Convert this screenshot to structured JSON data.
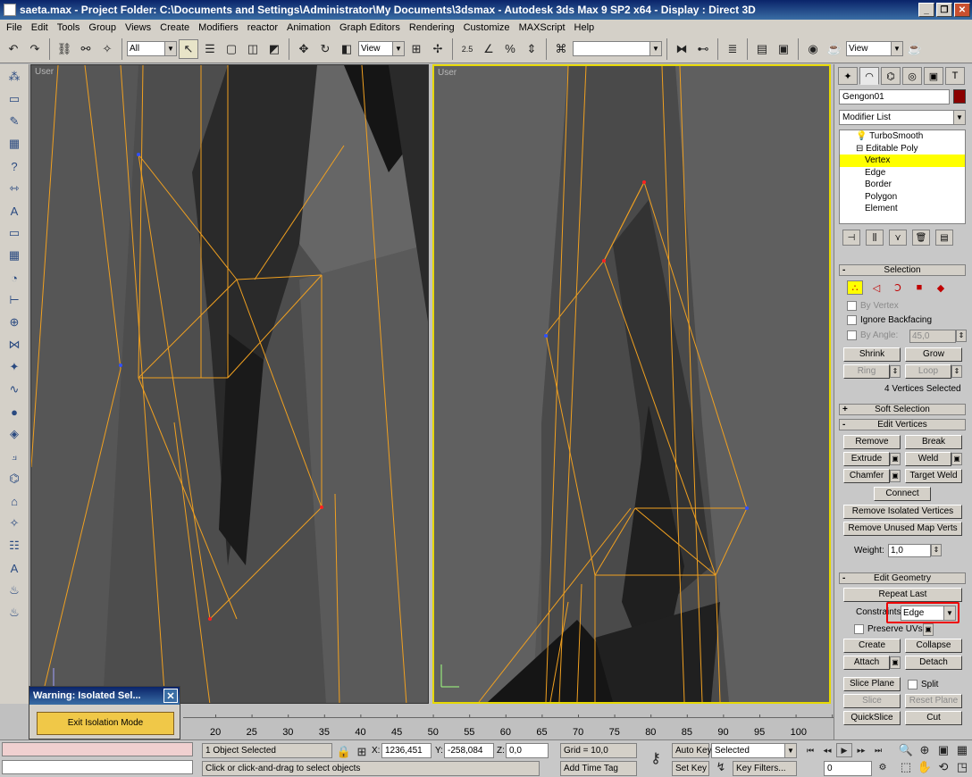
{
  "window": {
    "title": "saeta.max    - Project Folder: C:\\Documents and Settings\\Administrator\\My Documents\\3dsmax    - Autodesk 3ds Max 9 SP2 x64     - Display : Direct 3D"
  },
  "menu": [
    "File",
    "Edit",
    "Tools",
    "Group",
    "Views",
    "Create",
    "Modifiers",
    "reactor",
    "Animation",
    "Graph Editors",
    "Rendering",
    "Customize",
    "MAXScript",
    "Help"
  ],
  "toolbar": {
    "filter_value": "All",
    "ref_coord_value": "View",
    "named_sel_value": "",
    "view2_value": "View",
    "snap_label": "2.5"
  },
  "viewports": {
    "left_label": "User",
    "right_label": "User"
  },
  "command_panel": {
    "object_name": "Gengon01",
    "modifier_list": "Modifier List",
    "stack": [
      {
        "label": "TurboSmooth",
        "level": "top"
      },
      {
        "label": "Editable Poly",
        "level": "top"
      },
      {
        "label": "Vertex",
        "level": "sub",
        "selected": true
      },
      {
        "label": "Edge",
        "level": "sub"
      },
      {
        "label": "Border",
        "level": "sub"
      },
      {
        "label": "Polygon",
        "level": "sub"
      },
      {
        "label": "Element",
        "level": "sub"
      }
    ],
    "selection": {
      "title": "Selection",
      "by_vertex": "By Vertex",
      "ignore_backfacing": "Ignore Backfacing",
      "by_angle": "By Angle:",
      "by_angle_value": "45,0",
      "shrink": "Shrink",
      "grow": "Grow",
      "ring": "Ring",
      "loop": "Loop",
      "status": "4 Vertices Selected"
    },
    "soft_selection": {
      "title": "Soft Selection"
    },
    "edit_vertices": {
      "title": "Edit Vertices",
      "remove": "Remove",
      "break": "Break",
      "extrude": "Extrude",
      "weld": "Weld",
      "chamfer": "Chamfer",
      "target_weld": "Target Weld",
      "connect": "Connect",
      "remove_isolated": "Remove Isolated Vertices",
      "remove_unused": "Remove Unused Map Verts",
      "weight_label": "Weight:",
      "weight_value": "1,0"
    },
    "edit_geometry": {
      "title": "Edit Geometry",
      "repeat_last": "Repeat Last",
      "constraints_label": "Constraints:",
      "constraints_value": "Edge",
      "preserve_uvs": "Preserve UVs",
      "create": "Create",
      "collapse": "Collapse",
      "attach": "Attach",
      "detach": "Detach",
      "slice_plane": "Slice Plane",
      "split": "Split",
      "slice": "Slice",
      "reset_plane": "Reset Plane",
      "quickslice": "QuickSlice",
      "cut": "Cut"
    }
  },
  "popup": {
    "title": "Warning: Isolated Sel...",
    "button": "Exit Isolation Mode"
  },
  "timeline": {
    "ticks": [
      "20",
      "25",
      "30",
      "35",
      "40",
      "45",
      "50",
      "55",
      "60",
      "65",
      "70",
      "75",
      "80",
      "85",
      "90",
      "95",
      "100"
    ]
  },
  "status": {
    "objects_selected": "1 Object Selected",
    "prompt": "Click or click-and-drag to select objects",
    "x_label": "X:",
    "x_value": "1236,451",
    "y_label": "Y:",
    "y_value": "-258,084",
    "z_label": "Z:",
    "z_value": "0,0",
    "grid": "Grid = 10,0",
    "add_time_tag": "Add Time Tag",
    "auto_key": "Auto Key",
    "set_key": "Set Key",
    "selected_value": "Selected",
    "key_filters": "Key Filters...",
    "frame_value": "0"
  }
}
